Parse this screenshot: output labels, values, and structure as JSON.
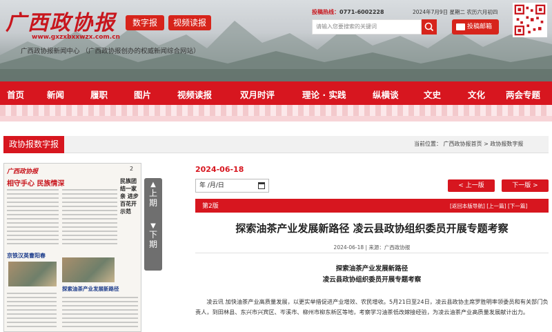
{
  "header": {
    "logo": "广西政协报",
    "logo_url": "www.gxzxbxxwzx.com.cn",
    "subtitle": "广西政协报新闻中心 （广西政协报创办的权威新闻综合网站）",
    "btn_digital": "数字报",
    "btn_video": "视频读报",
    "hotline_label": "投稿热线：",
    "hotline_number": "0771-6002228",
    "date_text": "2024年7月9日 星期二 农历六月初四",
    "search_placeholder": "请输入您要搜索的关键词",
    "mail_btn": "投稿邮箱"
  },
  "nav": {
    "items": [
      "首页",
      "新闻",
      "履职",
      "图片",
      "视频读报",
      "双月时评",
      "理论 · 实践",
      "纵横谈",
      "文史",
      "文化",
      "两会专题"
    ]
  },
  "section": {
    "title": "政协报数字报",
    "breadcrumb": "当前位置： 广西政协报首页 > 政协报数字报"
  },
  "paper_thumb": {
    "logo": "广西政协报",
    "page_no": "2",
    "headline": "相守手心  民族情深",
    "headline2": "京铁汉英曹阳春",
    "headline3": "探索油茶产业发展新路径",
    "side": "民族团结一家亲 进步百花开 示范"
  },
  "pager": {
    "up_label": "上一期",
    "down_label": "下一期",
    "up_chars": [
      "上",
      "期"
    ],
    "down_chars": [
      "下",
      "期"
    ]
  },
  "article": {
    "pub_date": "2024-06-18",
    "date_input": "年 /月/日",
    "prev_edition": "< 上一版",
    "next_edition": "下一版 >",
    "edition_label": "第2版",
    "edition_links": "[返回本版导航]  [上一篇]  [下一篇]",
    "title": "探索油茶产业发展新路径 凌云县政协组织委员开展专题考察",
    "meta": "2024-06-18 | 来源：广西政协报",
    "subtitle1": "探索油茶产业发展新路径",
    "subtitle2": "凌云县政协组织委员开展专题考察",
    "body": "凌云讯  加快油茶产业高质量发展，以更实举措促进产业增效、农民增收。5月21日至24日，凌云县政协主席罗胜明率领委员和有关部门负责人，到田林县、东兴市兴宾区、岑溪市、柳州市柳东新区等地，考察学习油茶低改嫁接经验，为凌云油茶产业高质量发展献计出力。"
  },
  "colors": {
    "brand_red": "#d7161f"
  }
}
